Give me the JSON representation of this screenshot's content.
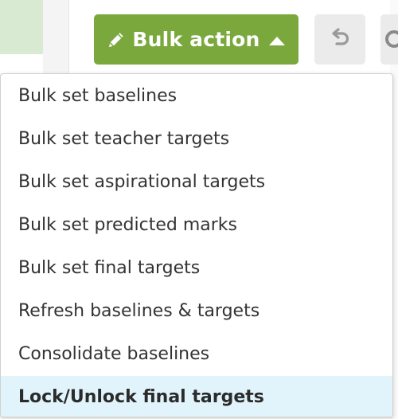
{
  "toolbar": {
    "bulk_action_label": "Bulk action",
    "bulk_action_color": "#7aa83c",
    "pencil_icon": "pencil-icon",
    "caret_icon": "caret-up-icon",
    "undo_icon": "undo-icon"
  },
  "menu": {
    "items": [
      {
        "label": "Bulk set baselines"
      },
      {
        "label": "Bulk set teacher targets"
      },
      {
        "label": "Bulk set aspirational targets"
      },
      {
        "label": "Bulk set predicted marks"
      },
      {
        "label": "Bulk set final targets"
      },
      {
        "label": "Refresh baselines & targets"
      },
      {
        "label": "Consolidate baselines"
      },
      {
        "label": "Lock/Unlock final targets"
      }
    ],
    "highlighted_index": 7,
    "highlight_color": "#e1f4fb"
  }
}
